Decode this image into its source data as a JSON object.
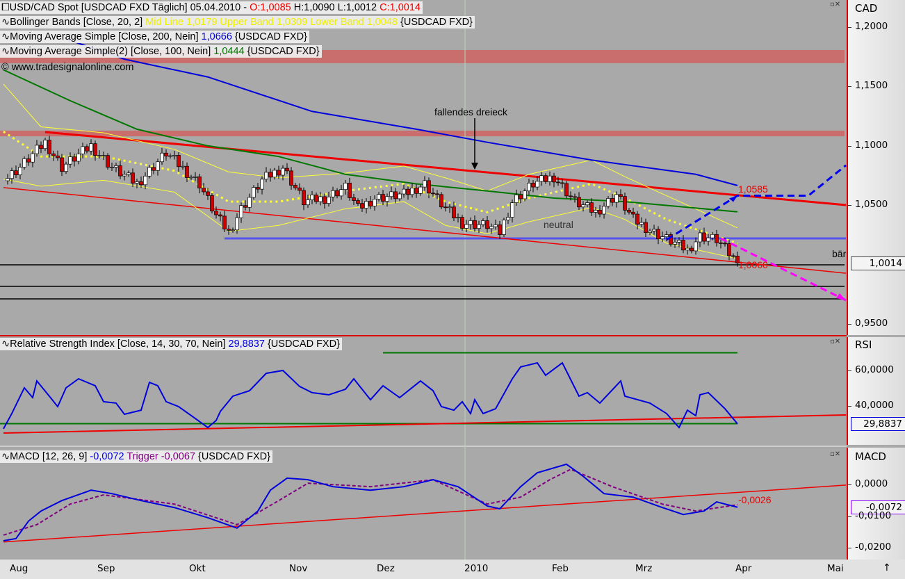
{
  "header": {
    "symbol_line": {
      "name": "USD/CAD Spot [USDCAD FXD  Täglich] 05.04.2010 - ",
      "o": "O:1,0085",
      "h": " H:1,0090",
      "l": " L:1,0012",
      "c": " C:1,0014"
    },
    "bollinger": {
      "name": "Bollinger Bands [Close, 20, 2] ",
      "values": "Mid Line 1,0179 Upper Band 1,0309 Lower Band 1,0048",
      "src": " {USDCAD FXD}"
    },
    "ma200": {
      "name": "Moving Average Simple [Close, 200, Nein] ",
      "value": "1,0666",
      "src": " {USDCAD FXD}"
    },
    "ma100": {
      "name": "Moving Average Simple(2) [Close, 100, Nein] ",
      "value": "1,0444",
      "src": " {USDCAD FXD}"
    },
    "copyright": "© www.tradesignalonline.com",
    "rsi": {
      "name": "Relative Strength Index [Close, 14, 30, 70, Nein] ",
      "value": "29,8837",
      "src": " {USDCAD FXD}"
    },
    "macd": {
      "name": "MACD [12, 26, 9] ",
      "value": "-0,0072",
      "trigger": " Trigger -0,0067",
      "src": " {USDCAD FXD}"
    }
  },
  "axes": {
    "price": {
      "title": "CAD",
      "ticks": [
        "1,2000",
        "1,1500",
        "1,1000",
        "1,0500",
        "0,9500"
      ],
      "tick_values": [
        1.2,
        1.15,
        1.1,
        1.05,
        0.95
      ],
      "current": "1,0014"
    },
    "rsi": {
      "title": "RSI",
      "ticks": [
        "60,0000",
        "40,0000"
      ],
      "tick_values": [
        60,
        40
      ],
      "current": "29,8837"
    },
    "macd": {
      "title": "MACD",
      "ticks": [
        "0,0000",
        "-0,0100",
        "-0,0200"
      ],
      "tick_values": [
        0,
        -0.01,
        -0.02
      ],
      "current": "-0,0072"
    },
    "months": [
      "Aug",
      "Sep",
      "Okt",
      "Nov",
      "Dez",
      "2010",
      "Feb",
      "Mrz",
      "Apr",
      "Mai"
    ],
    "month_days": [
      2,
      23,
      45,
      69,
      90,
      111,
      132,
      152,
      176,
      198
    ]
  },
  "annotations": {
    "triangle": "fallendes dreieck",
    "neutral": "neutral",
    "level_high": "1,0585",
    "level_low": "1,0060",
    "bear": "bär",
    "macd_level": "-0,0026"
  },
  "colors": {
    "ma200": "#0000dd",
    "ma100": "#007700",
    "bollinger": "#ffff33",
    "trend": "#ee0000",
    "support": "#5555ee",
    "bull_arrow": "#0000ee",
    "bear_arrow": "#ff00ff",
    "rsi": "#0000dd",
    "macd": "#0000dd",
    "trigger": "#800080"
  },
  "chart_data": [
    {
      "type": "candlestick",
      "title": "USD/CAD Spot",
      "x_unit": "trading day since Aug 2009",
      "ylim": [
        0.93,
        1.2228
      ],
      "close": [
        [
          0,
          1.0706
        ],
        [
          4,
          1.082
        ],
        [
          10,
          1.103
        ],
        [
          14,
          1.082
        ],
        [
          21,
          1.1
        ],
        [
          26,
          1.082
        ],
        [
          32,
          1.068
        ],
        [
          39,
          1.094
        ],
        [
          47,
          1.068
        ],
        [
          51,
          1.041
        ],
        [
          54,
          1.027
        ],
        [
          57,
          1.047
        ],
        [
          62,
          1.071
        ],
        [
          67,
          1.082
        ],
        [
          72,
          1.053
        ],
        [
          77,
          1.056
        ],
        [
          82,
          1.065
        ],
        [
          85,
          1.047
        ],
        [
          89,
          1.056
        ],
        [
          96,
          1.059
        ],
        [
          101,
          1.068
        ],
        [
          106,
          1.047
        ],
        [
          110,
          1.035
        ],
        [
          116,
          1.033
        ],
        [
          119,
          1.027
        ],
        [
          122,
          1.053
        ],
        [
          127,
          1.068
        ],
        [
          132,
          1.074
        ],
        [
          137,
          1.053
        ],
        [
          142,
          1.044
        ],
        [
          147,
          1.059
        ],
        [
          151,
          1.038
        ],
        [
          156,
          1.027
        ],
        [
          161,
          1.018
        ],
        [
          164,
          1.012
        ],
        [
          167,
          1.024
        ],
        [
          171,
          1.021
        ],
        [
          176,
          1.0014
        ]
      ],
      "ma200": [
        [
          15,
          1.19
        ],
        [
          29,
          1.173
        ],
        [
          49,
          1.158
        ],
        [
          74,
          1.129
        ],
        [
          99,
          1.114
        ],
        [
          116,
          1.103
        ],
        [
          141,
          1.088
        ],
        [
          166,
          1.076
        ],
        [
          176,
          1.0666
        ]
      ],
      "ma100": [
        [
          0,
          1.164
        ],
        [
          16,
          1.138
        ],
        [
          32,
          1.114
        ],
        [
          49,
          1.1
        ],
        [
          66,
          1.091
        ],
        [
          82,
          1.076
        ],
        [
          99,
          1.068
        ],
        [
          116,
          1.062
        ],
        [
          132,
          1.056
        ],
        [
          149,
          1.053
        ],
        [
          176,
          1.0444
        ]
      ],
      "bb_mid": [
        [
          0,
          1.112
        ],
        [
          9,
          1.091
        ],
        [
          24,
          1.091
        ],
        [
          41,
          1.079
        ],
        [
          54,
          1.053
        ],
        [
          66,
          1.053
        ],
        [
          82,
          1.062
        ],
        [
          96,
          1.068
        ],
        [
          106,
          1.053
        ],
        [
          116,
          1.044
        ],
        [
          126,
          1.056
        ],
        [
          141,
          1.068
        ],
        [
          149,
          1.056
        ],
        [
          159,
          1.038
        ],
        [
          176,
          1.0179
        ]
      ],
      "bb_halfwidth": [
        0.04,
        0.025,
        0.02,
        0.018,
        0.025,
        0.02,
        0.015,
        0.015,
        0.02,
        0.018,
        0.02,
        0.02,
        0.018,
        0.02,
        0.013
      ],
      "resistance_line": [
        [
          10,
          1.1116
        ],
        [
          202,
          1.0501
        ]
      ],
      "lower_trend_line": [
        [
          0,
          1.0648
        ],
        [
          202,
          0.9927
        ]
      ],
      "support_line": [
        [
          53,
          1.022
        ],
        [
          202,
          1.022
        ]
      ],
      "horizontal_levels": [
        0.9998,
        0.9816,
        0.9711
      ],
      "zones": [
        [
          1.1696,
          1.1807
        ],
        [
          1.108,
          1.1128
        ]
      ],
      "bull_scenario": [
        [
          159,
          1.021
        ],
        [
          176,
          1.058
        ],
        [
          193,
          1.058
        ],
        [
          202,
          1.0836
        ]
      ],
      "bear_scenario": [
        [
          172,
          1.022
        ],
        [
          202,
          0.9699
        ]
      ]
    },
    {
      "type": "line",
      "title": "RSI",
      "ylim": [
        20,
        75
      ],
      "levels": [
        30,
        70
      ],
      "values": [
        [
          0,
          27.1
        ],
        [
          2,
          35.7
        ],
        [
          5,
          50.2
        ],
        [
          7,
          44.7
        ],
        [
          8,
          54.1
        ],
        [
          11,
          45.5
        ],
        [
          13,
          39.6
        ],
        [
          15,
          50.2
        ],
        [
          18,
          55.3
        ],
        [
          22,
          51.4
        ],
        [
          24,
          42.4
        ],
        [
          27,
          41.6
        ],
        [
          29,
          35.3
        ],
        [
          33,
          37.6
        ],
        [
          35,
          53.3
        ],
        [
          37,
          51.4
        ],
        [
          39,
          42.4
        ],
        [
          42,
          39.6
        ],
        [
          46,
          32.9
        ],
        [
          49,
          27.8
        ],
        [
          51,
          31.8
        ],
        [
          52,
          36.9
        ],
        [
          55,
          45.5
        ],
        [
          59,
          48.6
        ],
        [
          63,
          58.4
        ],
        [
          67,
          60
        ],
        [
          71,
          51
        ],
        [
          74,
          47.5
        ],
        [
          78,
          46.3
        ],
        [
          82,
          49.4
        ],
        [
          84,
          55.3
        ],
        [
          88,
          43.5
        ],
        [
          91,
          51.4
        ],
        [
          95,
          44.7
        ],
        [
          100,
          54.1
        ],
        [
          103,
          48.6
        ],
        [
          105,
          39.6
        ],
        [
          108,
          37.6
        ],
        [
          110,
          42.4
        ],
        [
          112,
          35.7
        ],
        [
          113,
          43.5
        ],
        [
          115,
          35.7
        ],
        [
          118,
          38.4
        ],
        [
          122,
          55.3
        ],
        [
          124,
          62
        ],
        [
          128,
          64.3
        ],
        [
          130,
          57.3
        ],
        [
          134,
          64.3
        ],
        [
          138,
          45.5
        ],
        [
          140,
          47.5
        ],
        [
          143,
          41.6
        ],
        [
          148,
          54.1
        ],
        [
          149,
          45.5
        ],
        [
          155,
          41.6
        ],
        [
          159,
          35.7
        ],
        [
          162,
          27.8
        ],
        [
          164,
          37.6
        ],
        [
          166,
          34.5
        ],
        [
          167,
          46.3
        ],
        [
          169,
          47.5
        ],
        [
          173,
          38.4
        ],
        [
          176,
          29.9
        ]
      ],
      "trend_line": [
        [
          0,
          24.7
        ],
        [
          202,
          34.9
        ]
      ]
    },
    {
      "type": "line",
      "title": "MACD",
      "ylim": [
        -0.0238,
        0.0035
      ],
      "macd": [
        [
          0,
          -0.0178
        ],
        [
          3,
          -0.0171
        ],
        [
          6,
          -0.0116
        ],
        [
          9,
          -0.0084
        ],
        [
          14,
          -0.0051
        ],
        [
          21,
          -0.0018
        ],
        [
          26,
          -0.0029
        ],
        [
          33,
          -0.0051
        ],
        [
          41,
          -0.0073
        ],
        [
          49,
          -0.0105
        ],
        [
          56,
          -0.0138
        ],
        [
          61,
          -0.0084
        ],
        [
          64,
          -0.0018
        ],
        [
          68,
          0.002
        ],
        [
          73,
          0.0015
        ],
        [
          79,
          -0.0007
        ],
        [
          88,
          -0.0018
        ],
        [
          96,
          -0.0007
        ],
        [
          103,
          0.0015
        ],
        [
          109,
          -0.0007
        ],
        [
          116,
          -0.0068
        ],
        [
          119,
          -0.0077
        ],
        [
          124,
          -0.0007
        ],
        [
          128,
          0.0037
        ],
        [
          135,
          0.0064
        ],
        [
          139,
          0.0026
        ],
        [
          144,
          -0.0029
        ],
        [
          151,
          -0.004
        ],
        [
          158,
          -0.0073
        ],
        [
          163,
          -0.0095
        ],
        [
          168,
          -0.0084
        ],
        [
          171,
          -0.0055
        ],
        [
          176,
          -0.0072
        ]
      ],
      "trigger": [
        [
          0,
          -0.016
        ],
        [
          8,
          -0.0127
        ],
        [
          16,
          -0.0062
        ],
        [
          24,
          -0.0033
        ],
        [
          41,
          -0.0062
        ],
        [
          56,
          -0.0127
        ],
        [
          66,
          -0.0051
        ],
        [
          73,
          0.0004
        ],
        [
          88,
          -0.0007
        ],
        [
          103,
          0.0015
        ],
        [
          116,
          -0.0062
        ],
        [
          124,
          -0.004
        ],
        [
          131,
          0.0015
        ],
        [
          136,
          0.0048
        ],
        [
          146,
          -0.0007
        ],
        [
          158,
          -0.0062
        ],
        [
          166,
          -0.0084
        ],
        [
          176,
          -0.0064
        ]
      ],
      "trend_line": [
        [
          0,
          -0.0182
        ],
        [
          202,
          -0.0002
        ]
      ]
    }
  ]
}
